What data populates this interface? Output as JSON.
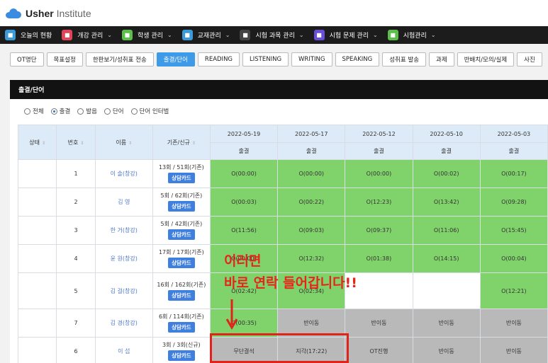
{
  "brand": {
    "name_bold": "Usher",
    "name_light": "Institute",
    "color": "#3b8be0"
  },
  "nav": [
    {
      "label": "오늘의 현황",
      "icon": "dashboard-icon",
      "color": "#3d9ad9",
      "chev": false
    },
    {
      "label": "개강 관리",
      "icon": "calendar-icon",
      "color": "#e0455a",
      "chev": true
    },
    {
      "label": "학생 관리",
      "icon": "student-icon",
      "color": "#5bbf4a",
      "chev": true
    },
    {
      "label": "교재관리",
      "icon": "book-icon",
      "color": "#3d9ad9",
      "chev": true
    },
    {
      "label": "시험 과목 관리",
      "icon": "document-icon",
      "color": "#444444",
      "chev": true
    },
    {
      "label": "시험 문제 관리",
      "icon": "quiz-icon",
      "color": "#6b4fd8",
      "chev": true
    },
    {
      "label": "시험관리",
      "icon": "list-icon",
      "color": "#5bbf4a",
      "chev": true
    }
  ],
  "tabs": [
    "OT명단",
    "목표설정",
    "한판보기/성취표 전송",
    "출결/단어",
    "READING",
    "LISTENING",
    "WRITING",
    "SPEAKING",
    "성취표 발송",
    "과제",
    "반배치/모의/실제",
    "사진"
  ],
  "active_tab": 3,
  "panel_title": "출결/단어",
  "filters": [
    {
      "label": "전체",
      "on": false
    },
    {
      "label": "출결",
      "on": true
    },
    {
      "label": "발음",
      "on": false
    },
    {
      "label": "단어",
      "on": false
    },
    {
      "label": "단어 인터벌",
      "on": false
    }
  ],
  "table": {
    "headers": {
      "status": "상태",
      "number": "번호",
      "name": "이름",
      "existing": "기존/신규"
    },
    "dates": [
      "2022-05-19",
      "2022-05-17",
      "2022-05-12",
      "2022-05-10",
      "2022-05-03"
    ],
    "sub_header": "출결",
    "card_label": "상담카드",
    "rows": [
      {
        "num": "1",
        "name": "이 솔(창강)",
        "count": "13회 / 51회(기존)",
        "cells": [
          [
            "O(00:00)",
            "green"
          ],
          [
            "O(00:00)",
            "green"
          ],
          [
            "O(00:00)",
            "green"
          ],
          [
            "O(00:02)",
            "green"
          ],
          [
            "O(00:17)",
            "green"
          ]
        ]
      },
      {
        "num": "2",
        "name": "김 영",
        "count": "5회 / 62회(기존)",
        "cells": [
          [
            "O(00:03)",
            "green"
          ],
          [
            "O(00:22)",
            "green"
          ],
          [
            "O(12:23)",
            "green"
          ],
          [
            "O(13:42)",
            "green"
          ],
          [
            "O(09:28)",
            "green"
          ]
        ]
      },
      {
        "num": "3",
        "name": "한 거(창강)",
        "count": "5회 / 42회(기존)",
        "cells": [
          [
            "O(11:56)",
            "green"
          ],
          [
            "O(09:03)",
            "green"
          ],
          [
            "O(09:37)",
            "green"
          ],
          [
            "O(11:06)",
            "green"
          ],
          [
            "O(15:45)",
            "green"
          ]
        ]
      },
      {
        "num": "4",
        "name": "윤 원(창강)",
        "count": "17회 / 17회(기존)",
        "cells": [
          [
            "O(00:00)",
            "green"
          ],
          [
            "O(12:32)",
            "green"
          ],
          [
            "O(01:38)",
            "green"
          ],
          [
            "O(14:15)",
            "green"
          ],
          [
            "O(00:04)",
            "green"
          ]
        ]
      },
      {
        "num": "5",
        "name": "김 걸(창강)",
        "count": "16회 / 162회(기존)",
        "cells": [
          [
            "O(02:42)",
            "green"
          ],
          [
            "O(02:34)",
            "green"
          ],
          [
            "",
            "white"
          ],
          [
            "",
            "white"
          ],
          [
            "O(12:21)",
            "green"
          ]
        ]
      },
      {
        "num": "7",
        "name": "김 경(창강)",
        "count": "6회 / 114회(기존)",
        "cells": [
          [
            "O(00:35)",
            "green"
          ],
          [
            "반이동",
            "gray"
          ],
          [
            "반이동",
            "gray"
          ],
          [
            "반이동",
            "gray"
          ],
          [
            "반이동",
            "gray"
          ]
        ]
      },
      {
        "num": "6",
        "name": "이 섭",
        "count": "3회 / 3회(신규)",
        "cells": [
          [
            "무단결석",
            "gray"
          ],
          [
            "지각(17:22)",
            "gray"
          ],
          [
            "OT진행",
            "gray"
          ],
          [
            "반이동",
            "gray"
          ],
          [
            "반이동",
            "gray"
          ]
        ]
      }
    ]
  },
  "annotation": {
    "line1": "이러면",
    "line2": "바로 연락 들어갑니다!!",
    "color": "#e8231b"
  }
}
